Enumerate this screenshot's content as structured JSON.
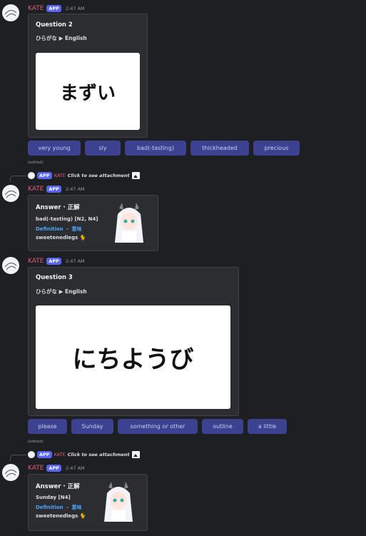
{
  "author": "KATE",
  "app_badge": "APP",
  "time": "2:47 AM",
  "edited": "(edited)",
  "reply_text": "Click to see attachment",
  "questions": [
    {
      "title": "Question 2",
      "subtitle": "ひらがな ▶ English",
      "word": "まずい",
      "choices": [
        "very young",
        "sly",
        "bad(-tasting)",
        "thickheaded",
        "precious"
      ]
    },
    {
      "title": "Question 3",
      "subtitle": "ひらがな ▶ English",
      "word": "にちようび",
      "choices": [
        "please",
        "Sunday",
        "something or other",
        "outline",
        "a little"
      ]
    }
  ],
  "answers": [
    {
      "title": "Answer · 正解",
      "word": "bad(-tasting) [N2, N4]",
      "definition": "Definition ・ 意味",
      "user": "sweetenedlegs 🐈"
    },
    {
      "title": "Answer · 正解",
      "word": "Sunday [N4]",
      "definition": "Definition ・ 意味",
      "user": "sweetenedlegs 🐈"
    }
  ],
  "colors": {
    "background": "#1e1f22",
    "embed": "#2b2d31",
    "author": "#e25b7b",
    "badge": "#5865f2",
    "button": "#3c4290",
    "link": "#4fa3f7"
  },
  "icons": {
    "avatar": "avatar-icon",
    "attachment": "image-icon"
  }
}
